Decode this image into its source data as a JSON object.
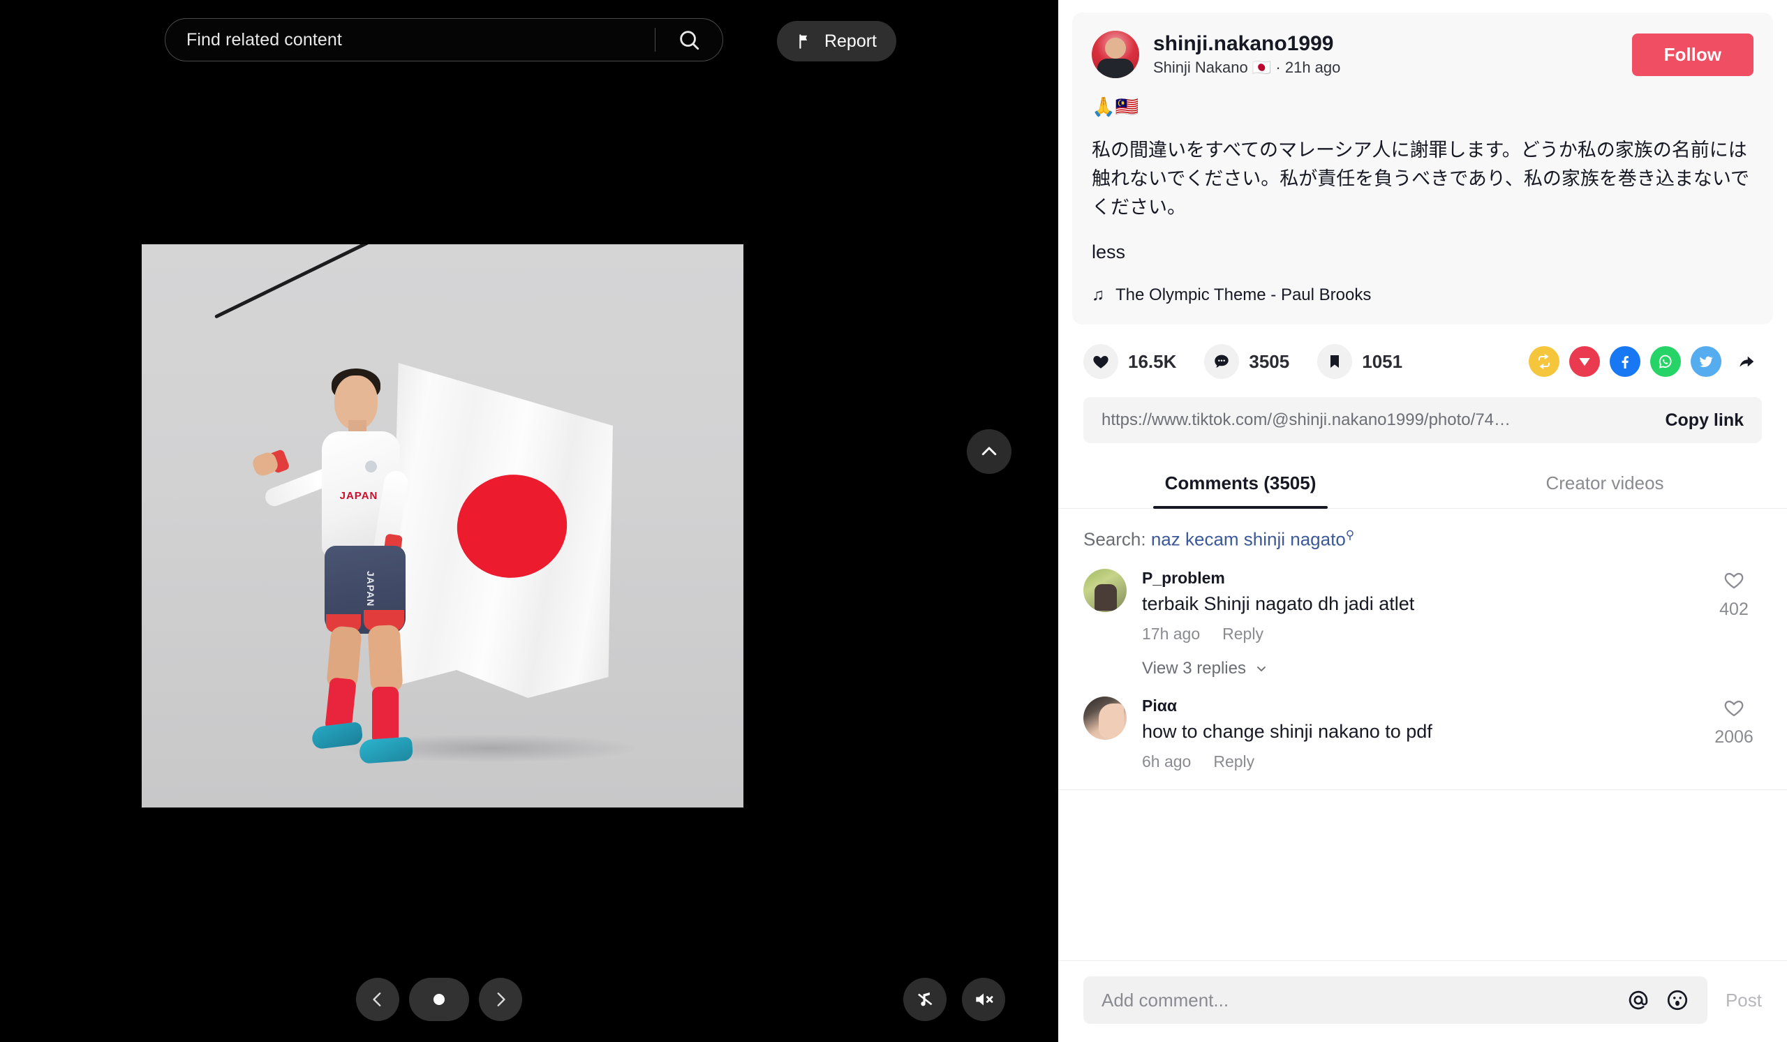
{
  "media": {
    "search_placeholder": "Find related content",
    "search_icon": "search-icon",
    "report_label": "Report",
    "report_icon": "flag-icon",
    "scroll_up_icon": "chevron-up-icon",
    "carousel": {
      "prev_icon": "chevron-left-icon",
      "next_icon": "chevron-right-icon",
      "dot_count": 1,
      "active_index": 0
    },
    "controls": [
      {
        "name": "music-off-icon",
        "label": "music off"
      },
      {
        "name": "volume-mute-icon",
        "label": "muted"
      }
    ],
    "photo_alt": "Japanese track cyclist in white JAPAN jersey holding a Japan flag on a pole"
  },
  "post": {
    "author": {
      "handle": "shinji.nakano1999",
      "display_name": "Shinji Nakano 🇯🇵",
      "timestamp": "21h ago",
      "separator": "·"
    },
    "follow_label": "Follow",
    "caption_emoji": "🙏🇲🇾",
    "caption": "私の間違いをすべてのマレーシア人に謝罪します。どうか私の家族の名前には触れないでください。私が責任を負うべきであり、私の家族を巻き込まないでください。",
    "expand_toggle": "less",
    "music_icon": "music-note-icon",
    "music": "The Olympic Theme - Paul Brooks"
  },
  "stats": {
    "like": {
      "icon": "heart-icon",
      "value": "16.5K"
    },
    "comment": {
      "icon": "comment-icon",
      "value": "3505"
    },
    "bookmark": {
      "icon": "bookmark-icon",
      "value": "1051"
    }
  },
  "share": {
    "icons": [
      {
        "name": "repost-icon",
        "color": "#f5c63c"
      },
      {
        "name": "telegram-icon",
        "color": "#ea3a50"
      },
      {
        "name": "facebook-icon",
        "color": "#1877f2"
      },
      {
        "name": "whatsapp-icon",
        "color": "#25d366"
      },
      {
        "name": "twitter-icon",
        "color": "#55acee"
      },
      {
        "name": "share-arrow-icon",
        "color": "#161823"
      }
    ]
  },
  "link_bar": {
    "url": "https://www.tiktok.com/@shinji.nakano1999/photo/74…",
    "copy_label": "Copy link"
  },
  "tabs": [
    {
      "label": "Comments (3505)",
      "active": true
    },
    {
      "label": "Creator videos",
      "active": false
    }
  ],
  "comment_search": {
    "prefix": "Search:",
    "query": "naz kecam shinji nagato",
    "icon": "search-icon"
  },
  "comments": [
    {
      "user": "P_problem",
      "text": "terbaik Shinji nagato dh jadi atlet",
      "time": "17h ago",
      "reply_label": "Reply",
      "like_icon": "heart-outline-icon",
      "likes": "402",
      "replies_label": "View 3 replies",
      "replies_icon": "chevron-down-icon"
    },
    {
      "user": "Piαα",
      "text": "how to change shinji nakano to pdf",
      "time": "6h ago",
      "reply_label": "Reply",
      "like_icon": "heart-outline-icon",
      "likes": "2006"
    }
  ],
  "composer": {
    "placeholder": "Add comment...",
    "mention_icon": "at-icon",
    "emoji_icon": "emoji-icon",
    "post_label": "Post"
  },
  "colors": {
    "brand_pink": "#f04e63",
    "link_blue": "#3b5998",
    "text_primary": "#161823",
    "text_muted": "#8a8b91",
    "panel_bg": "#ffffff",
    "card_bg": "#f8f8f8",
    "media_bg": "#000000"
  }
}
